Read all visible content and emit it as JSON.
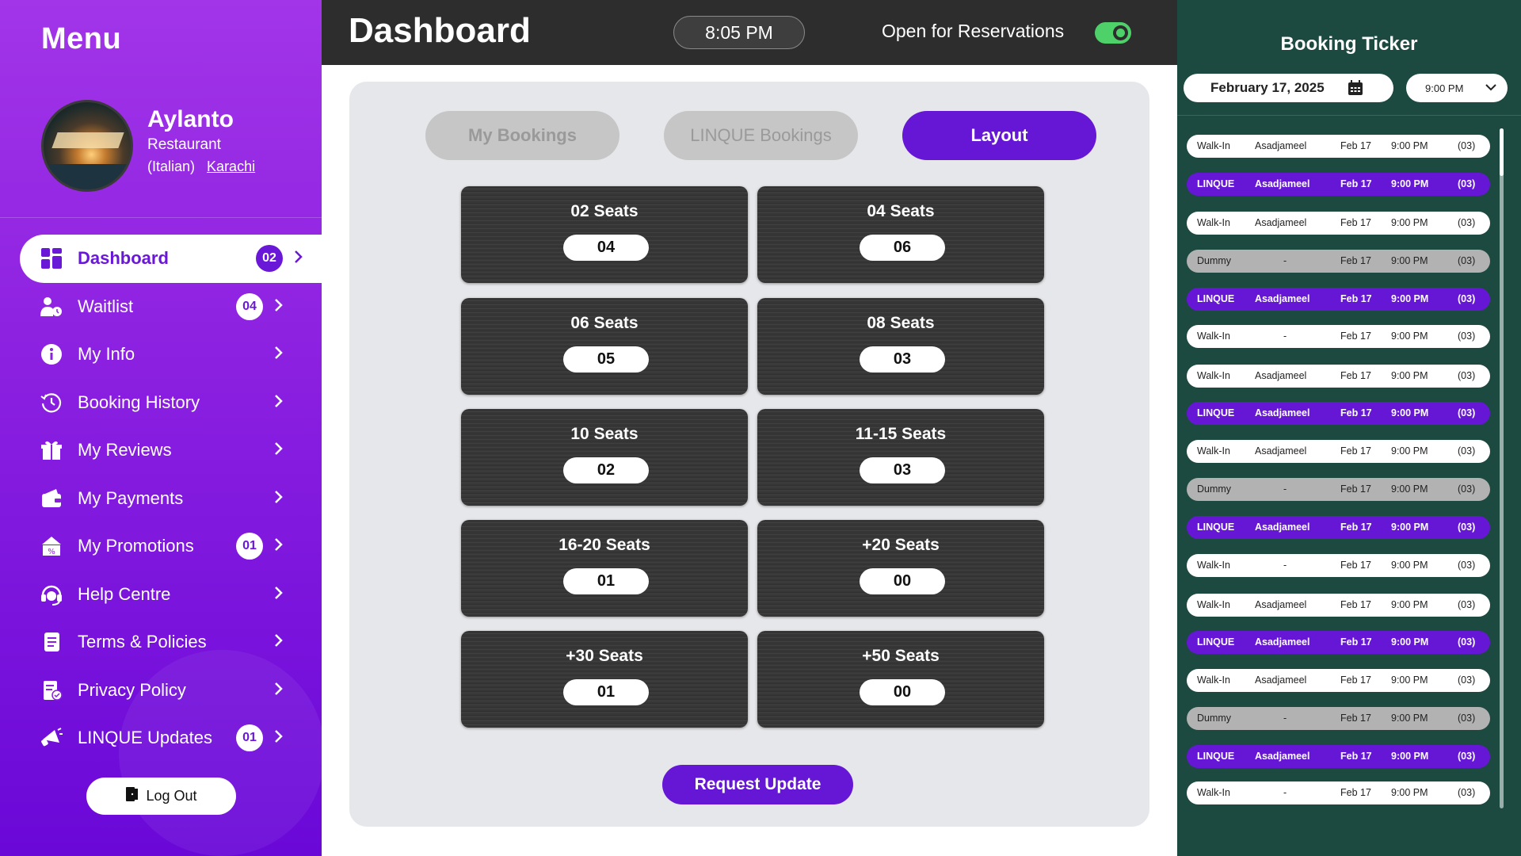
{
  "sidebar": {
    "title": "Menu",
    "profile": {
      "name": "Aylanto",
      "type": "Restaurant",
      "cuisine": "(Italian)",
      "city": "Karachi"
    },
    "items": [
      {
        "label": "Dashboard",
        "badge": "02",
        "active": true
      },
      {
        "label": "Waitlist",
        "badge": "04"
      },
      {
        "label": "My Info",
        "badge": ""
      },
      {
        "label": "Booking History",
        "badge": ""
      },
      {
        "label": "My Reviews",
        "badge": ""
      },
      {
        "label": "My Payments",
        "badge": ""
      },
      {
        "label": "My Promotions",
        "badge": "01"
      },
      {
        "label": "Help Centre",
        "badge": ""
      },
      {
        "label": "Terms & Policies",
        "badge": ""
      },
      {
        "label": "Privacy Policy",
        "badge": ""
      },
      {
        "label": "LINQUE Updates",
        "badge": "01"
      }
    ],
    "logout_label": "Log Out"
  },
  "header": {
    "title": "Dashboard",
    "clock": "8:05  PM",
    "reservations_label": "Open for Reservations",
    "reservations_open": true
  },
  "tabs": [
    "My Bookings",
    "LINQUE Bookings",
    "Layout"
  ],
  "seats": [
    {
      "label": "02 Seats",
      "count": "04"
    },
    {
      "label": "04 Seats",
      "count": "06"
    },
    {
      "label": "06 Seats",
      "count": "05"
    },
    {
      "label": "08 Seats",
      "count": "03"
    },
    {
      "label": "10 Seats",
      "count": "02"
    },
    {
      "label": "11-15 Seats",
      "count": "03"
    },
    {
      "label": "16-20 Seats",
      "count": "01"
    },
    {
      "label": "+20 Seats",
      "count": "00"
    },
    {
      "label": "+30 Seats",
      "count": "01"
    },
    {
      "label": "+50 Seats",
      "count": "00"
    }
  ],
  "request_update_label": "Request Update",
  "ticker": {
    "title": "Booking Ticker",
    "date": "February 17, 2025",
    "time": "9:00  PM",
    "rows": [
      {
        "type": "Walk-In",
        "name": "Asadjameel",
        "date": "Feb 17",
        "time": "9:00 PM",
        "count": "(03)"
      },
      {
        "type": "LINQUE",
        "name": "Asadjameel",
        "date": "Feb 17",
        "time": "9:00 PM",
        "count": "(03)"
      },
      {
        "type": "Walk-In",
        "name": "Asadjameel",
        "date": "Feb 17",
        "time": "9:00 PM",
        "count": "(03)"
      },
      {
        "type": "Dummy",
        "name": "-",
        "date": "Feb 17",
        "time": "9:00 PM",
        "count": "(03)"
      },
      {
        "type": "LINQUE",
        "name": "Asadjameel",
        "date": "Feb 17",
        "time": "9:00 PM",
        "count": "(03)"
      },
      {
        "type": "Walk-In",
        "name": "-",
        "date": "Feb 17",
        "time": "9:00 PM",
        "count": "(03)"
      },
      {
        "type": "Walk-In",
        "name": "Asadjameel",
        "date": "Feb 17",
        "time": "9:00 PM",
        "count": "(03)"
      },
      {
        "type": "LINQUE",
        "name": "Asadjameel",
        "date": "Feb 17",
        "time": "9:00 PM",
        "count": "(03)"
      },
      {
        "type": "Walk-In",
        "name": "Asadjameel",
        "date": "Feb 17",
        "time": "9:00 PM",
        "count": "(03)"
      },
      {
        "type": "Dummy",
        "name": "-",
        "date": "Feb 17",
        "time": "9:00 PM",
        "count": "(03)"
      },
      {
        "type": "LINQUE",
        "name": "Asadjameel",
        "date": "Feb 17",
        "time": "9:00 PM",
        "count": "(03)"
      },
      {
        "type": "Walk-In",
        "name": "-",
        "date": "Feb 17",
        "time": "9:00 PM",
        "count": "(03)"
      },
      {
        "type": "Walk-In",
        "name": "Asadjameel",
        "date": "Feb 17",
        "time": "9:00 PM",
        "count": "(03)"
      },
      {
        "type": "LINQUE",
        "name": "Asadjameel",
        "date": "Feb 17",
        "time": "9:00 PM",
        "count": "(03)"
      },
      {
        "type": "Walk-In",
        "name": "Asadjameel",
        "date": "Feb 17",
        "time": "9:00 PM",
        "count": "(03)"
      },
      {
        "type": "Dummy",
        "name": "-",
        "date": "Feb 17",
        "time": "9:00 PM",
        "count": "(03)"
      },
      {
        "type": "LINQUE",
        "name": "Asadjameel",
        "date": "Feb 17",
        "time": "9:00 PM",
        "count": "(03)"
      },
      {
        "type": "Walk-In",
        "name": "-",
        "date": "Feb 17",
        "time": "9:00 PM",
        "count": "(03)"
      }
    ]
  },
  "colors": {
    "accent": "#6617d6",
    "sidebar_top": "#a235e8",
    "sidebar_bottom": "#6a08d8",
    "header_bg": "#2d2d2d",
    "ticker_bg": "#1d4a40",
    "toggle_on": "#4fd16a"
  },
  "icons": {
    "nav": [
      "dashboard-grid-icon",
      "waitlist-person-clock-icon",
      "info-icon",
      "history-clock-icon",
      "reviews-gift-icon",
      "wallet-icon",
      "promotions-icon",
      "headset-icon",
      "document-icon",
      "privacy-document-icon",
      "megaphone-icon"
    ],
    "logout": "logout-door-icon",
    "calendar": "calendar-icon",
    "chevron": "chevron-right-icon"
  }
}
